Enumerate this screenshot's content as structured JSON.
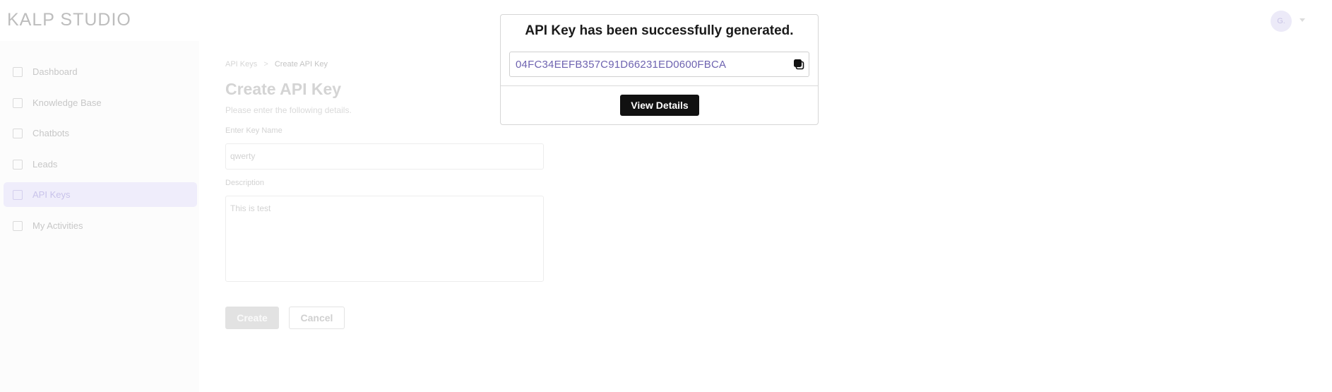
{
  "header": {
    "logo": "KALP STUDIO",
    "avatar_initial": "G."
  },
  "sidebar": {
    "items": [
      {
        "label": "Dashboard",
        "icon": "dashboard-icon",
        "active": false
      },
      {
        "label": "Knowledge Base",
        "icon": "folder-icon",
        "active": false
      },
      {
        "label": "Chatbots",
        "icon": "chat-icon",
        "active": false
      },
      {
        "label": "Leads",
        "icon": "leads-icon",
        "active": false
      },
      {
        "label": "API Keys",
        "icon": "key-icon",
        "active": true
      },
      {
        "label": "My Activities",
        "icon": "activity-icon",
        "active": false
      }
    ]
  },
  "main": {
    "breadcrumb": [
      "API Keys",
      ">",
      "Create API Key"
    ],
    "title": "Create API Key",
    "subtitle": "Please enter the following details.",
    "key_name_label": "Enter Key Name",
    "key_name_value": "qwerty",
    "description_label": "Description",
    "description_value": "This is test",
    "create_label": "Create",
    "cancel_label": "Cancel"
  },
  "modal": {
    "title": "API Key has been successfully generated.",
    "api_key": "04FC34EEFB357C91D66231ED0600FBCA",
    "copy_icon": "copy-icon",
    "view_details_label": "View Details"
  },
  "colors": {
    "accent": "#6e63b0",
    "active_nav_bg": "#efedfb",
    "primary_button": "#111111"
  }
}
